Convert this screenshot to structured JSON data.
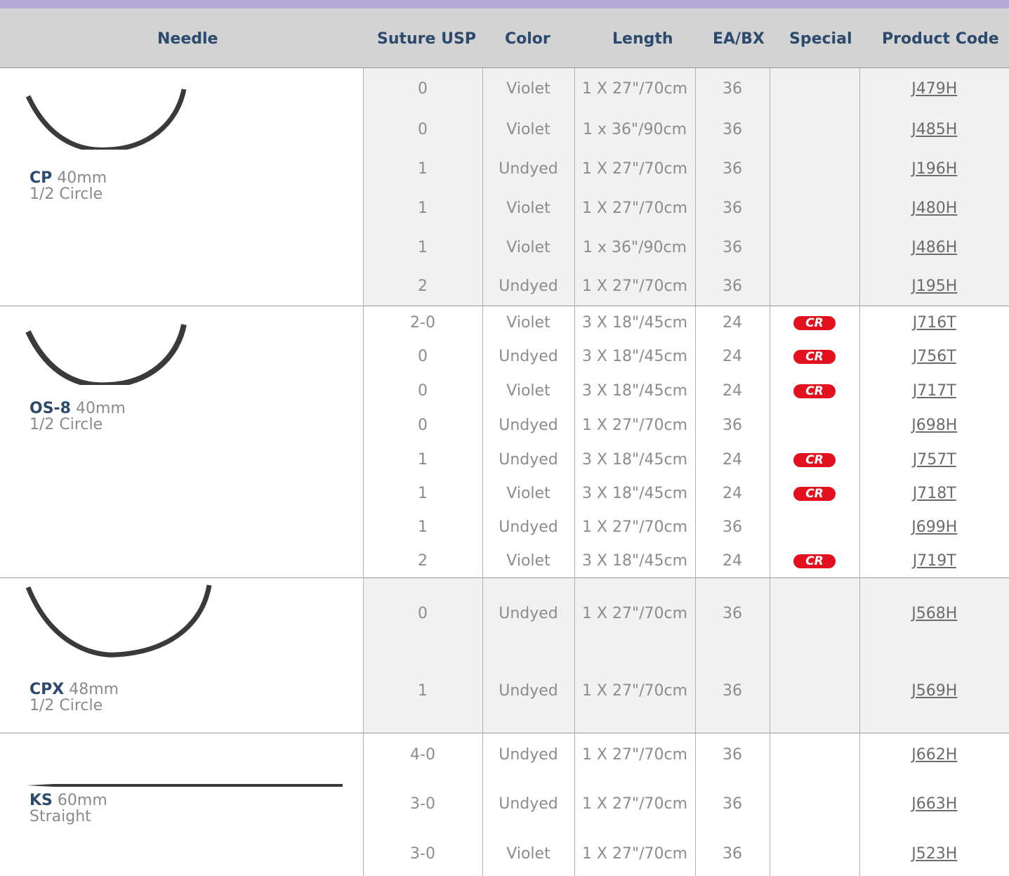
{
  "columns": {
    "needle": "Needle",
    "suture_usp": "Suture USP",
    "color": "Color",
    "length": "Length",
    "ea_bx": "EA/BX",
    "special": "Special",
    "product_code": "Product Code"
  },
  "colors": {
    "top_bar": "#b5acd6",
    "header_bg": "#d3d3d3",
    "header_text": "#2c4a6e",
    "cr_badge": "#e3101e",
    "row_shade": "#f1f1f1"
  },
  "sections": [
    {
      "needle_name": "CP",
      "needle_size": "40mm",
      "needle_shape": "1/2 Circle",
      "icon": "half-circle-needle-icon",
      "rows": [
        {
          "usp": "0",
          "color": "Violet",
          "length": "1 X 27\"/70cm",
          "eabx": "36",
          "special": "",
          "code": "J479H"
        },
        {
          "usp": "0",
          "color": "Violet",
          "length": "1 x 36\"/90cm",
          "eabx": "36",
          "special": "",
          "code": "J485H"
        },
        {
          "usp": "1",
          "color": "Undyed",
          "length": "1 X 27\"/70cm",
          "eabx": "36",
          "special": "",
          "code": "J196H"
        },
        {
          "usp": "1",
          "color": "Violet",
          "length": "1 X 27\"/70cm",
          "eabx": "36",
          "special": "",
          "code": "J480H"
        },
        {
          "usp": "1",
          "color": "Violet",
          "length": "1 x 36\"/90cm",
          "eabx": "36",
          "special": "",
          "code": "J486H"
        },
        {
          "usp": "2",
          "color": "Undyed",
          "length": "1 X 27\"/70cm",
          "eabx": "36",
          "special": "",
          "code": "J195H"
        }
      ]
    },
    {
      "needle_name": "OS-8",
      "needle_size": "40mm",
      "needle_shape": "1/2 Circle",
      "icon": "half-circle-needle-icon",
      "rows": [
        {
          "usp": "2-0",
          "color": "Violet",
          "length": "3 X 18\"/45cm",
          "eabx": "24",
          "special": "CR",
          "code": "J716T"
        },
        {
          "usp": "0",
          "color": "Undyed",
          "length": "3 X 18\"/45cm",
          "eabx": "24",
          "special": "CR",
          "code": "J756T"
        },
        {
          "usp": "0",
          "color": "Violet",
          "length": "3 X 18\"/45cm",
          "eabx": "24",
          "special": "CR",
          "code": "J717T"
        },
        {
          "usp": "0",
          "color": "Undyed",
          "length": "1 X 27\"/70cm",
          "eabx": "36",
          "special": "",
          "code": "J698H"
        },
        {
          "usp": "1",
          "color": "Undyed",
          "length": "3 X 18\"/45cm",
          "eabx": "24",
          "special": "CR",
          "code": "J757T"
        },
        {
          "usp": "1",
          "color": "Violet",
          "length": "3 X 18\"/45cm",
          "eabx": "24",
          "special": "CR",
          "code": "J718T"
        },
        {
          "usp": "1",
          "color": "Undyed",
          "length": "1 X 27\"/70cm",
          "eabx": "36",
          "special": "",
          "code": "J699H"
        },
        {
          "usp": "2",
          "color": "Violet",
          "length": "3 X 18\"/45cm",
          "eabx": "24",
          "special": "CR",
          "code": "J719T"
        }
      ]
    },
    {
      "needle_name": "CPX",
      "needle_size": "48mm",
      "needle_shape": "1/2 Circle",
      "icon": "half-circle-needle-icon",
      "rows": [
        {
          "usp": "0",
          "color": "Undyed",
          "length": "1 X 27\"/70cm",
          "eabx": "36",
          "special": "",
          "code": "J568H"
        },
        {
          "usp": "1",
          "color": "Undyed",
          "length": "1 X 27\"/70cm",
          "eabx": "36",
          "special": "",
          "code": "J569H"
        }
      ]
    },
    {
      "needle_name": "KS",
      "needle_size": "60mm",
      "needle_shape": "Straight",
      "icon": "straight-needle-icon",
      "rows": [
        {
          "usp": "4-0",
          "color": "Undyed",
          "length": "1 X 27\"/70cm",
          "eabx": "36",
          "special": "",
          "code": "J662H"
        },
        {
          "usp": "3-0",
          "color": "Undyed",
          "length": "1 X 27\"/70cm",
          "eabx": "36",
          "special": "",
          "code": "J663H"
        },
        {
          "usp": "3-0",
          "color": "Violet",
          "length": "1 X 27\"/70cm",
          "eabx": "36",
          "special": "",
          "code": "J523H"
        }
      ]
    }
  ]
}
